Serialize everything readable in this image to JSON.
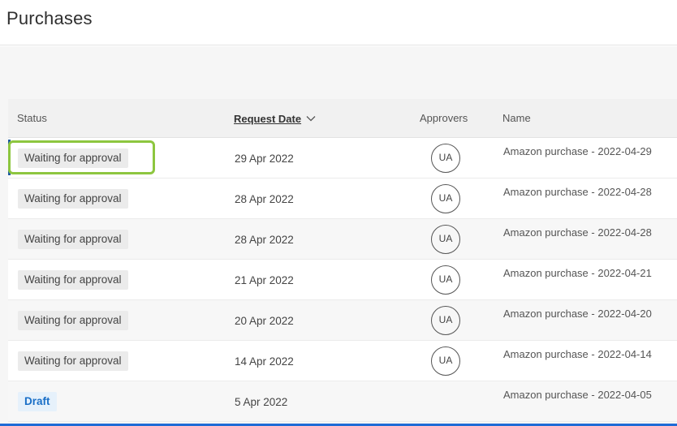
{
  "page": {
    "title": "Purchases"
  },
  "table": {
    "headers": {
      "status": "Status",
      "request_date": "Request Date",
      "approvers": "Approvers",
      "name": "Name"
    },
    "sort": {
      "column": "Request Date",
      "direction": "descending",
      "icon": "chevron-down-icon"
    },
    "rows": [
      {
        "status": "Waiting for approval",
        "request_date": "29 Apr 2022",
        "approver": "UA",
        "name": "Amazon purchase - 2022-04-29"
      },
      {
        "status": "Waiting for approval",
        "request_date": "28 Apr 2022",
        "approver": "UA",
        "name": "Amazon purchase - 2022-04-28"
      },
      {
        "status": "Waiting for approval",
        "request_date": "28 Apr 2022",
        "approver": "UA",
        "name": "Amazon purchase - 2022-04-28"
      },
      {
        "status": "Waiting for approval",
        "request_date": "21 Apr 2022",
        "approver": "UA",
        "name": "Amazon purchase - 2022-04-21"
      },
      {
        "status": "Waiting for approval",
        "request_date": "20 Apr 2022",
        "approver": "UA",
        "name": "Amazon purchase - 2022-04-20"
      },
      {
        "status": "Waiting for approval",
        "request_date": "14 Apr 2022",
        "approver": "UA",
        "name": "Amazon purchase - 2022-04-14"
      },
      {
        "status": "Draft",
        "request_date": "5 Apr 2022",
        "approver": "",
        "name": "Amazon purchase - 2022-04-05"
      }
    ]
  },
  "colors": {
    "focus_ring": "#8dc63f",
    "selection_bar": "#1e5aa0",
    "draft_text": "#1a6fc7",
    "draft_background": "#e6f1fb",
    "status_background": "#ebebeb"
  }
}
